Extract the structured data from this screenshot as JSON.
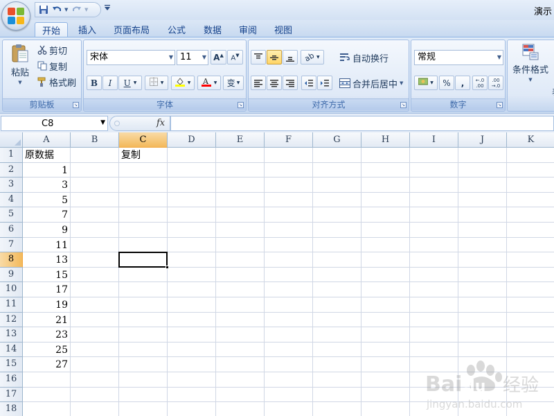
{
  "window": {
    "title": "演示"
  },
  "office_button": {
    "colors": [
      "#e8502b",
      "#7cb935",
      "#1c8fd8",
      "#f7b719"
    ]
  },
  "quick_access": {
    "save_icon": "save-icon",
    "undo_icon": "undo-icon",
    "redo_icon": "redo-icon",
    "customize_icon": "customize-qat-icon"
  },
  "ribbon_tabs": [
    {
      "label": "开始",
      "active": true
    },
    {
      "label": "插入",
      "active": false
    },
    {
      "label": "页面布局",
      "active": false
    },
    {
      "label": "公式",
      "active": false
    },
    {
      "label": "数据",
      "active": false
    },
    {
      "label": "审阅",
      "active": false
    },
    {
      "label": "视图",
      "active": false
    }
  ],
  "clipboard": {
    "group_label": "剪贴板",
    "paste_label": "粘贴",
    "cut_label": "剪切",
    "copy_label": "复制",
    "format_painter_label": "格式刷"
  },
  "font": {
    "group_label": "字体",
    "font_name": "宋体",
    "font_size": "11",
    "bold": "B",
    "italic": "I",
    "underline": "U",
    "phonetic": "变",
    "font_color": "#ff0000",
    "fill_color": "#ffff00"
  },
  "alignment": {
    "group_label": "对齐方式",
    "wrap_text_label": "自动换行",
    "merge_center_label": "合并后居中"
  },
  "number": {
    "group_label": "数字",
    "format": "常规",
    "percent": "%",
    "comma": ","
  },
  "styles": {
    "conditional_format_label": "条件格式",
    "cut_off_label": "表"
  },
  "formula_bar": {
    "name_box": "C8",
    "fx_label": "fx",
    "formula": ""
  },
  "sheet": {
    "columns": [
      "A",
      "B",
      "C",
      "D",
      "E",
      "F",
      "G",
      "H",
      "I",
      "J",
      "K"
    ],
    "rows": [
      "1",
      "2",
      "3",
      "4",
      "5",
      "6",
      "7",
      "8",
      "9",
      "10",
      "11",
      "12",
      "13",
      "14",
      "15",
      "16",
      "17",
      "18"
    ],
    "selected_column": "C",
    "selected_row": "8",
    "cells": [
      {
        "ref": "A1",
        "value": "原数据",
        "type": "text"
      },
      {
        "ref": "C1",
        "value": "复制",
        "type": "text"
      },
      {
        "ref": "A2",
        "value": "1",
        "type": "num"
      },
      {
        "ref": "A3",
        "value": "3",
        "type": "num"
      },
      {
        "ref": "A4",
        "value": "5",
        "type": "num"
      },
      {
        "ref": "A5",
        "value": "7",
        "type": "num"
      },
      {
        "ref": "A6",
        "value": "9",
        "type": "num"
      },
      {
        "ref": "A7",
        "value": "11",
        "type": "num"
      },
      {
        "ref": "A8",
        "value": "13",
        "type": "num"
      },
      {
        "ref": "A9",
        "value": "15",
        "type": "num"
      },
      {
        "ref": "A10",
        "value": "17",
        "type": "num"
      },
      {
        "ref": "A11",
        "value": "19",
        "type": "num"
      },
      {
        "ref": "A12",
        "value": "21",
        "type": "num"
      },
      {
        "ref": "A13",
        "value": "23",
        "type": "num"
      },
      {
        "ref": "A14",
        "value": "25",
        "type": "num"
      },
      {
        "ref": "A15",
        "value": "27",
        "type": "num"
      }
    ]
  },
  "watermark": {
    "brand": "Bai",
    "brand2": "du",
    "product": "经验",
    "url": "jingyan.baidu.com"
  }
}
